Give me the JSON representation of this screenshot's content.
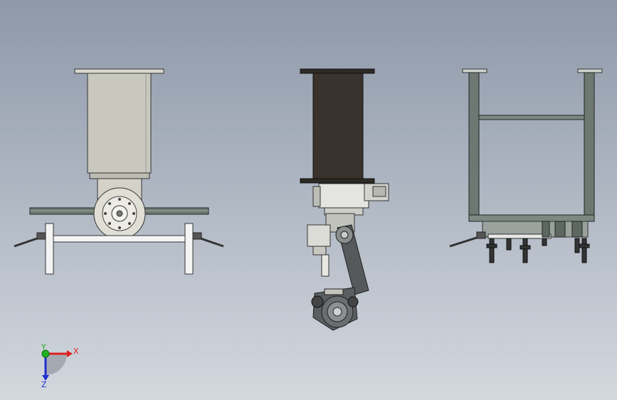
{
  "viewport": {
    "background_top": "#8e98a8",
    "background_bottom": "#d3d8de"
  },
  "views": [
    {
      "id": "side-view",
      "part": "gantry-column-with-wrist-flange",
      "column_color": "#c9c8bf"
    },
    {
      "id": "front-view",
      "part": "column-with-robot-arm",
      "column_color": "#3a322c"
    },
    {
      "id": "rear-view",
      "part": "open-frame-structure",
      "frame_color": "#6e7872"
    }
  ],
  "triad": {
    "x_label": "X",
    "y_label": "Y",
    "z_label": "Z",
    "x_color": "#e02020",
    "y_color": "#22b022",
    "z_color": "#2030d0"
  }
}
